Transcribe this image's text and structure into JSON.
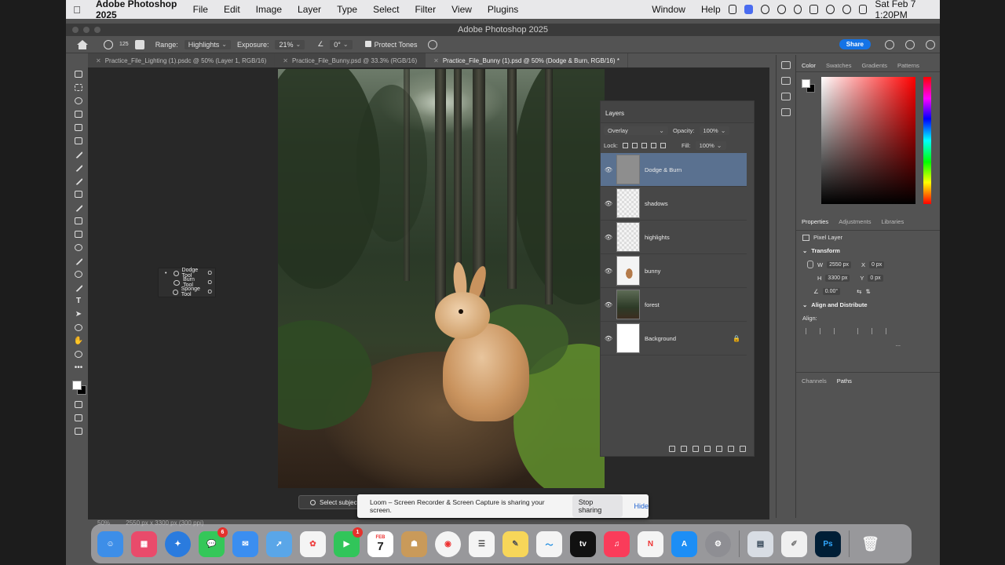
{
  "menubar": {
    "app_name": "Adobe Photoshop 2025",
    "menus": [
      "File",
      "Edit",
      "Image",
      "Layer",
      "Type",
      "Select",
      "Filter",
      "View",
      "Plugins",
      "Window",
      "Help"
    ],
    "clock": "Sat Feb 7  1:20PM"
  },
  "titlebar": {
    "title": "Adobe Photoshop 2025"
  },
  "options": {
    "brush_size": "125",
    "range_label": "Range:",
    "range_value": "Highlights",
    "exposure_label": "Exposure:",
    "exposure_value": "21%",
    "angle_value": "0°",
    "protect_tones": "Protect Tones",
    "share": "Share"
  },
  "tabs": [
    {
      "label": "Practice_File_Lighting (1).psdc @ 50% (Layer 1, RGB/16)"
    },
    {
      "label": "Practice_File_Bunny.psd @ 33.3% (RGB/16)"
    },
    {
      "label": "Practice_File_Bunny (1).psd @ 50% (Dodge & Burn, RGB/16) *"
    }
  ],
  "flyout": {
    "items": [
      {
        "label": "Dodge Tool",
        "key": "O"
      },
      {
        "label": "Burn Tool",
        "key": "O"
      },
      {
        "label": "Sponge Tool",
        "key": "O"
      }
    ]
  },
  "layers_panel": {
    "title": "Layers",
    "blend_mode": "Overlay",
    "opacity_label": "Opacity:",
    "opacity": "100%",
    "lock_label": "Lock:",
    "fill_label": "Fill:",
    "fill": "100%",
    "layers": [
      {
        "name": "Dodge & Burn"
      },
      {
        "name": "shadows"
      },
      {
        "name": "highlights"
      },
      {
        "name": "bunny"
      },
      {
        "name": "forest"
      },
      {
        "name": "Background"
      }
    ]
  },
  "color_panel": {
    "tabs": [
      "Color",
      "Swatches",
      "Gradients",
      "Patterns"
    ]
  },
  "properties_panel": {
    "tabs": [
      "Properties",
      "Adjustments",
      "Libraries"
    ],
    "type": "Pixel Layer",
    "transform_header": "Transform",
    "w_label": "W",
    "w_value": "2550 px",
    "h_label": "H",
    "h_value": "3300 px",
    "x_label": "X",
    "x_value": "0 px",
    "y_label": "Y",
    "y_value": "0 px",
    "angle": "0.00°",
    "align_header": "Align and Distribute",
    "align_label": "Align:",
    "more": "..."
  },
  "channels_tabs": [
    "Channels",
    "Paths"
  ],
  "status": {
    "zoom": "50%",
    "doc_size": "2550 px x 3300 px (300 ppi)"
  },
  "context_bar": {
    "select_subject": "Select subject"
  },
  "loom": {
    "message": "Loom – Screen Recorder & Screen Capture is sharing your screen.",
    "stop": "Stop sharing",
    "hide": "Hide"
  },
  "dock": {
    "messages_badge": "6",
    "facetime_badge": "1",
    "calendar_month": "FEB",
    "calendar_day": "7",
    "appletv_label": "tv",
    "ps_label": "Ps"
  }
}
